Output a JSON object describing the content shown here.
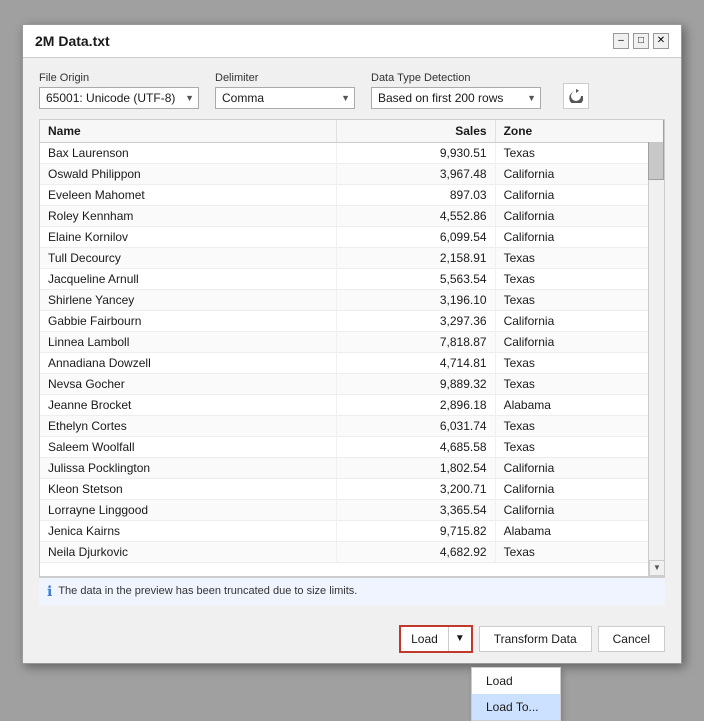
{
  "dialog": {
    "title": "2M Data.txt"
  },
  "title_bar": {
    "minimize_label": "–",
    "restore_label": "□",
    "close_label": "✕"
  },
  "options": {
    "file_origin_label": "File Origin",
    "file_origin_value": "65001: Unicode (UTF-8)",
    "delimiter_label": "Delimiter",
    "delimiter_value": "Comma",
    "data_type_label": "Data Type Detection",
    "data_type_value": "Based on first 200 rows"
  },
  "table": {
    "columns": [
      "Name",
      "Sales",
      "Zone"
    ],
    "rows": [
      {
        "name": "Bax Laurenson",
        "sales": "9,930.51",
        "zone": "Texas"
      },
      {
        "name": "Oswald Philippon",
        "sales": "3,967.48",
        "zone": "California"
      },
      {
        "name": "Eveleen Mahomet",
        "sales": "897.03",
        "zone": "California"
      },
      {
        "name": "Roley Kennham",
        "sales": "4,552.86",
        "zone": "California"
      },
      {
        "name": "Elaine Kornilov",
        "sales": "6,099.54",
        "zone": "California"
      },
      {
        "name": "Tull Decourcy",
        "sales": "2,158.91",
        "zone": "Texas"
      },
      {
        "name": "Jacqueline Arnull",
        "sales": "5,563.54",
        "zone": "Texas"
      },
      {
        "name": "Shirlene Yancey",
        "sales": "3,196.10",
        "zone": "Texas"
      },
      {
        "name": "Gabbie Fairbourn",
        "sales": "3,297.36",
        "zone": "California"
      },
      {
        "name": "Linnea Lamboll",
        "sales": "7,818.87",
        "zone": "California"
      },
      {
        "name": "Annadiana Dowzell",
        "sales": "4,714.81",
        "zone": "Texas"
      },
      {
        "name": "Nevsa Gocher",
        "sales": "9,889.32",
        "zone": "Texas"
      },
      {
        "name": "Jeanne Brocket",
        "sales": "2,896.18",
        "zone": "Alabama"
      },
      {
        "name": "Ethelyn Cortes",
        "sales": "6,031.74",
        "zone": "Texas"
      },
      {
        "name": "Saleem Woolfall",
        "sales": "4,685.58",
        "zone": "Texas"
      },
      {
        "name": "Julissa Pocklington",
        "sales": "1,802.54",
        "zone": "California"
      },
      {
        "name": "Kleon Stetson",
        "sales": "3,200.71",
        "zone": "California"
      },
      {
        "name": "Lorrayne Linggood",
        "sales": "3,365.54",
        "zone": "California"
      },
      {
        "name": "Jenica Kairns",
        "sales": "9,715.82",
        "zone": "Alabama"
      },
      {
        "name": "Neila Djurkovic",
        "sales": "4,682.92",
        "zone": "Texas"
      }
    ]
  },
  "info_bar": {
    "message": "The data in the preview has been truncated due to size limits."
  },
  "footer": {
    "load_label": "Load",
    "load_arrow": "▼",
    "transform_label": "Transform Data",
    "cancel_label": "Cancel"
  },
  "dropdown": {
    "items": [
      "Load",
      "Load To..."
    ]
  }
}
